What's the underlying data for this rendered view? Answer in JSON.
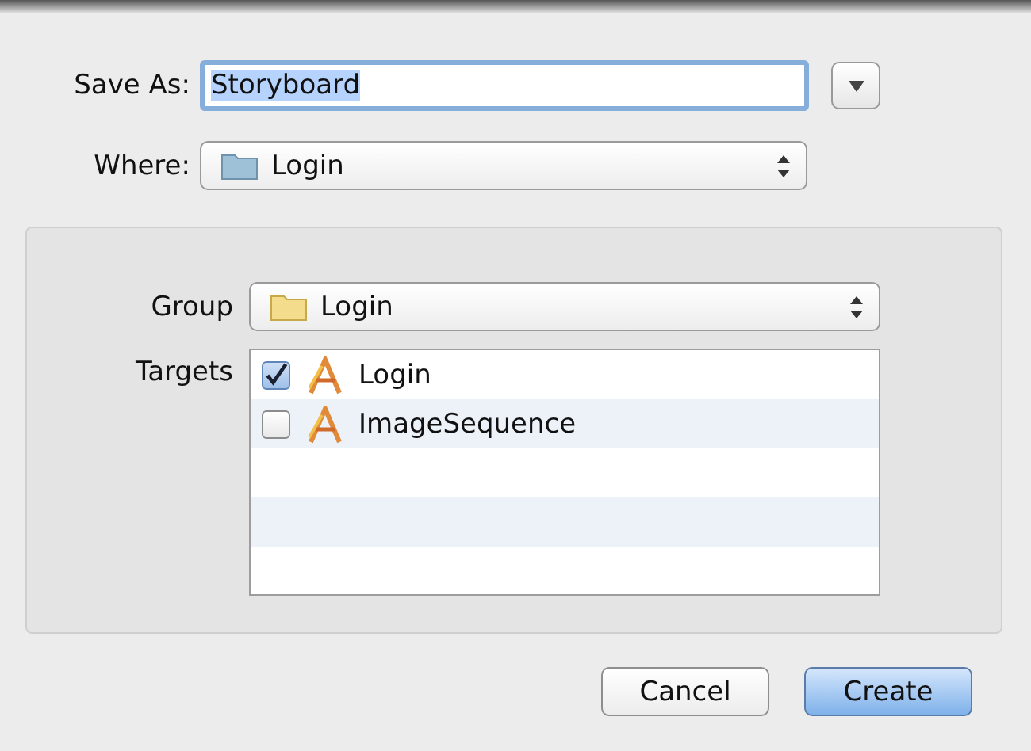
{
  "save_as": {
    "label": "Save As:",
    "value": "Storyboard",
    "selected_text": true
  },
  "where": {
    "label": "Where:",
    "value": "Login"
  },
  "group": {
    "label": "Group",
    "value": "Login"
  },
  "targets": {
    "label": "Targets",
    "items": [
      {
        "name": "Login",
        "checked": true
      },
      {
        "name": "ImageSequence",
        "checked": false
      }
    ]
  },
  "buttons": [
    {
      "label": "Cancel",
      "kind": "secondary"
    },
    {
      "label": "Create",
      "kind": "default"
    }
  ]
}
